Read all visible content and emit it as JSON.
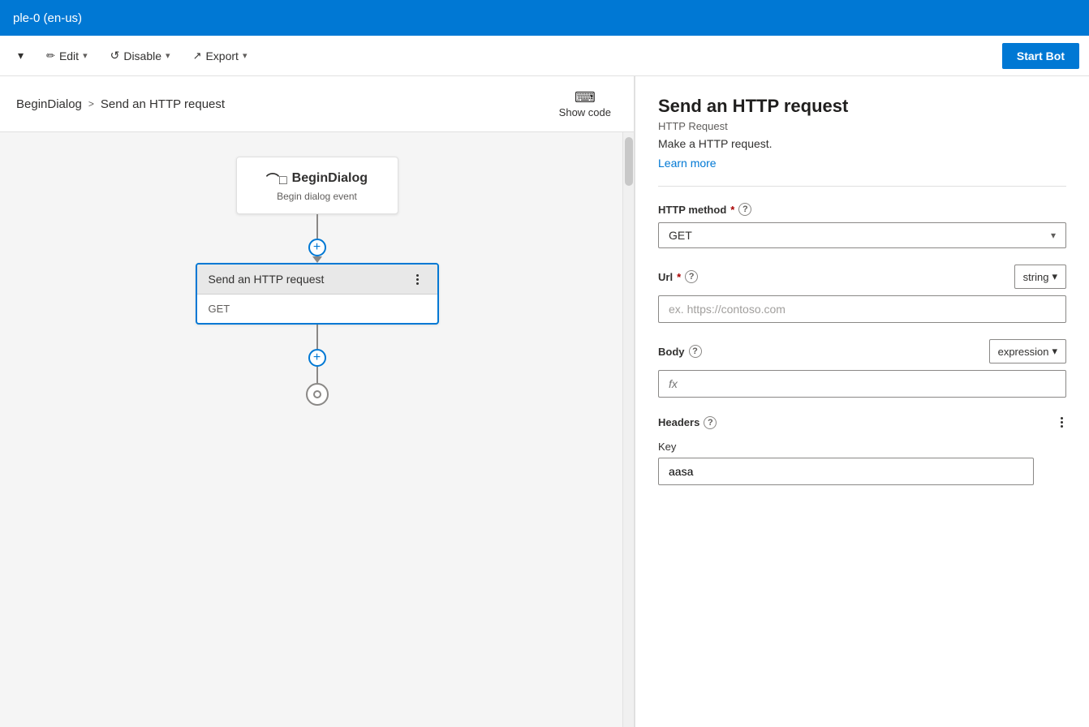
{
  "topbar": {
    "title": "ple-0 (en-us)"
  },
  "toolbar": {
    "edit_label": "Edit",
    "disable_label": "Disable",
    "export_label": "Export",
    "start_bot_label": "Start Bot"
  },
  "breadcrumb": {
    "parent": "BeginDialog",
    "separator": ">",
    "current": "Send an HTTP request",
    "show_code_label": "Show code"
  },
  "canvas": {
    "begin_dialog": {
      "icon": "⌒",
      "title": "BeginDialog",
      "subtitle": "Begin dialog event"
    },
    "http_node": {
      "title": "Send an HTTP request",
      "method": "GET",
      "menu_label": "..."
    }
  },
  "right_panel": {
    "title": "Send an HTTP request",
    "subtitle": "HTTP Request",
    "description": "Make a HTTP request.",
    "learn_more_label": "Learn more",
    "http_method": {
      "label": "HTTP method",
      "required": true,
      "value": "GET"
    },
    "url": {
      "label": "Url",
      "required": true,
      "type_value": "string",
      "placeholder": "ex. https://contoso.com"
    },
    "body": {
      "label": "Body",
      "type_value": "expression",
      "placeholder": "fx"
    },
    "headers": {
      "label": "Headers",
      "key_label": "Key",
      "key_value": "aasa"
    }
  },
  "icons": {
    "chevron_down": "▾",
    "chevron_right": "›",
    "question_mark": "?",
    "edit_icon": "✏",
    "disable_icon": "↺",
    "export_icon": "↗"
  }
}
